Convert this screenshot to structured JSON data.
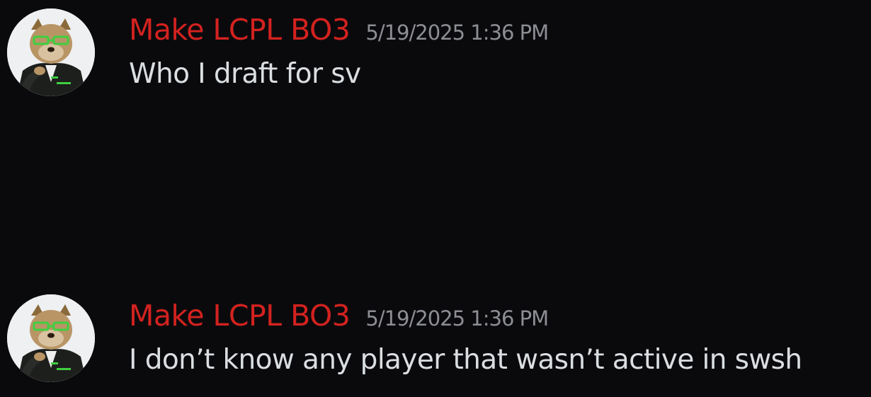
{
  "messages": [
    {
      "username": "Make LCPL BO3",
      "timestamp": "5/19/2025 1:36 PM",
      "text": "Who I draft for sv",
      "avatar_icon": "dog-in-suit-avatar-icon"
    },
    {
      "username": "Make LCPL BO3",
      "timestamp": "5/19/2025 1:36 PM",
      "text": "I don’t know any player that wasn’t active in swsh",
      "avatar_icon": "dog-in-suit-avatar-icon"
    }
  ],
  "colors": {
    "background": "#0a0a0d",
    "username": "#d3221f",
    "timestamp": "#8c8e93",
    "message_text": "#dbdee1"
  }
}
